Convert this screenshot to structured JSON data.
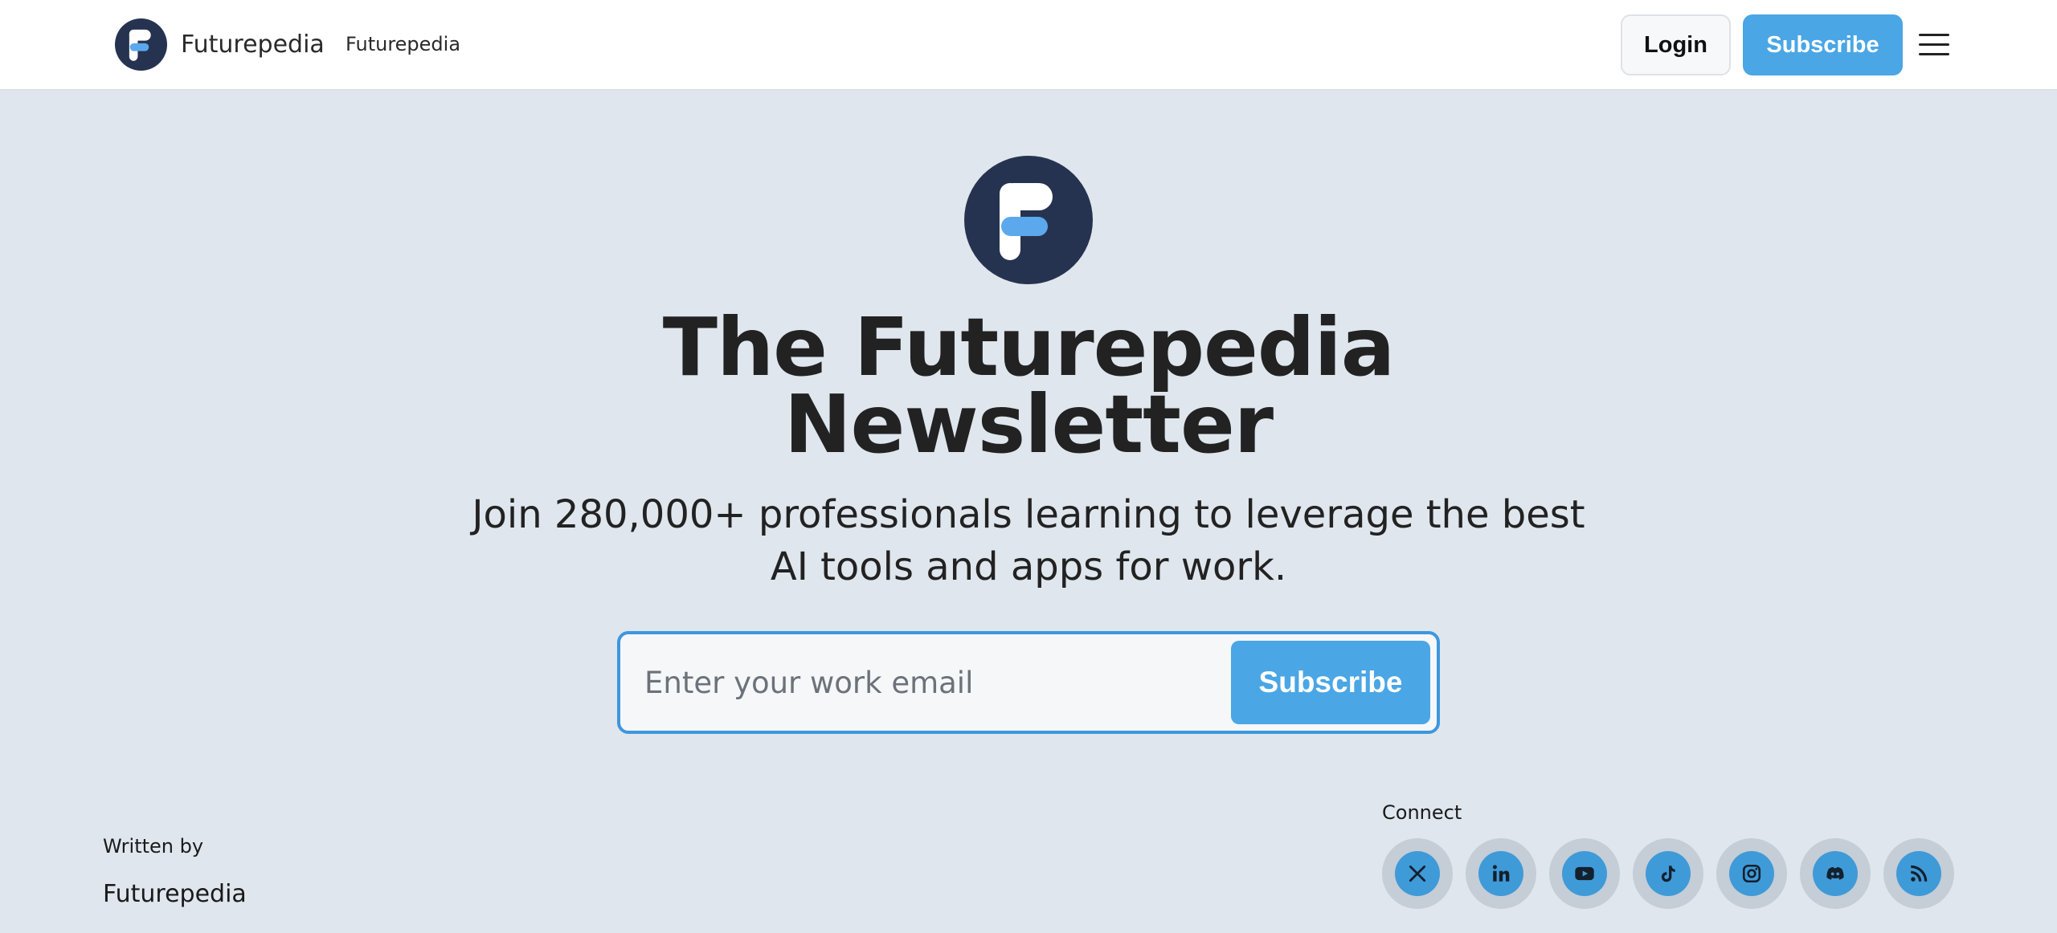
{
  "header": {
    "brand_name": "Futurepedia",
    "nav_link": "Futurepedia",
    "login_label": "Login",
    "subscribe_label": "Subscribe"
  },
  "hero": {
    "title_line1": "The Futurepedia",
    "title_line2": "Newsletter",
    "subtitle": "Join 280,000+ professionals learning to leverage the best AI tools and apps for work."
  },
  "signup": {
    "email_placeholder": "Enter your work email",
    "subscribe_label": "Subscribe"
  },
  "footer": {
    "written_by_label": "Written by",
    "author": "Futurepedia",
    "connect_label": "Connect",
    "social": [
      {
        "name": "x-icon"
      },
      {
        "name": "linkedin-icon"
      },
      {
        "name": "youtube-icon"
      },
      {
        "name": "tiktok-icon"
      },
      {
        "name": "instagram-icon"
      },
      {
        "name": "discord-icon"
      },
      {
        "name": "rss-icon"
      }
    ]
  },
  "colors": {
    "accent": "#4aa6e5",
    "logo_bg": "#263350",
    "page_bg": "#dfe6ed"
  }
}
